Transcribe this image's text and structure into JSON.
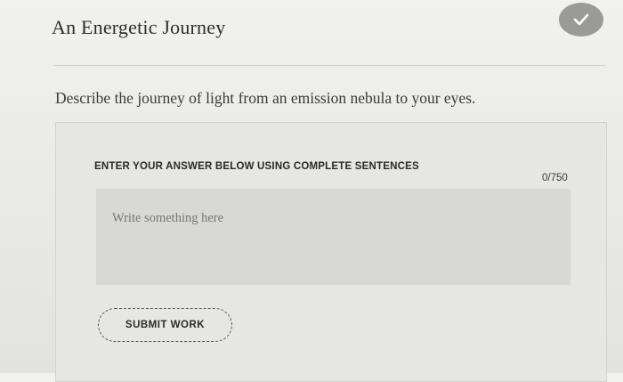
{
  "header": {
    "title": "An Energetic Journey",
    "status_icon": "check-icon"
  },
  "question": {
    "text": "Describe the journey of light from an emission nebula to your eyes."
  },
  "answer": {
    "instruction": "ENTER YOUR ANSWER BELOW USING COMPLETE SENTENCES",
    "char_count": "0/750",
    "placeholder": "Write something here",
    "value": ""
  },
  "actions": {
    "submit_label": "SUBMIT WORK"
  },
  "colors": {
    "badge": "#9a9a98",
    "card": "#e6e6e3",
    "input": "#d8d8d5"
  }
}
